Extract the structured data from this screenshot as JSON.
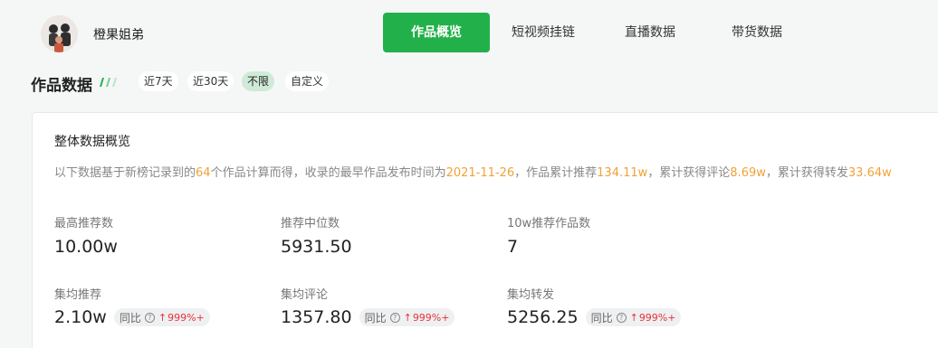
{
  "header": {
    "username": "橙果姐弟",
    "tabs": [
      {
        "label": "作品概览",
        "active": true
      },
      {
        "label": "短视频挂链",
        "active": false
      },
      {
        "label": "直播数据",
        "active": false
      },
      {
        "label": "带货数据",
        "active": false
      }
    ]
  },
  "section": {
    "title": "作品数据",
    "ranges": [
      {
        "label": "近7天",
        "active": false
      },
      {
        "label": "近30天",
        "active": false
      },
      {
        "label": "不限",
        "active": true
      },
      {
        "label": "自定义",
        "active": false
      }
    ]
  },
  "overview": {
    "title": "整体数据概览",
    "summary": {
      "p1": "以下数据基于新榜记录到的",
      "count": "64",
      "p2": "个作品计算而得，收录的最早作品发布时间为",
      "date": "2021-11-26",
      "p3": "，作品累计推荐",
      "rec": "134.11w",
      "p4": "，累计获得评论",
      "comments": "8.69w",
      "p5": "，累计获得转发",
      "shares": "33.64w"
    },
    "metrics_top": [
      {
        "label": "最高推荐数",
        "value": "10.00w"
      },
      {
        "label": "推荐中位数",
        "value": "5931.50"
      },
      {
        "label": "10w推荐作品数",
        "value": "7"
      }
    ],
    "metrics_bottom": [
      {
        "label": "集均推荐",
        "value": "2.10w",
        "yoy_label": "同比",
        "yoy_value": "999%+"
      },
      {
        "label": "集均评论",
        "value": "1357.80",
        "yoy_label": "同比",
        "yoy_value": "999%+"
      },
      {
        "label": "集均转发",
        "value": "5256.25",
        "yoy_label": "同比",
        "yoy_value": "999%+"
      }
    ]
  },
  "colors": {
    "accent": "#22b04a",
    "highlight": "#f2a139",
    "up": "#e8333c"
  }
}
